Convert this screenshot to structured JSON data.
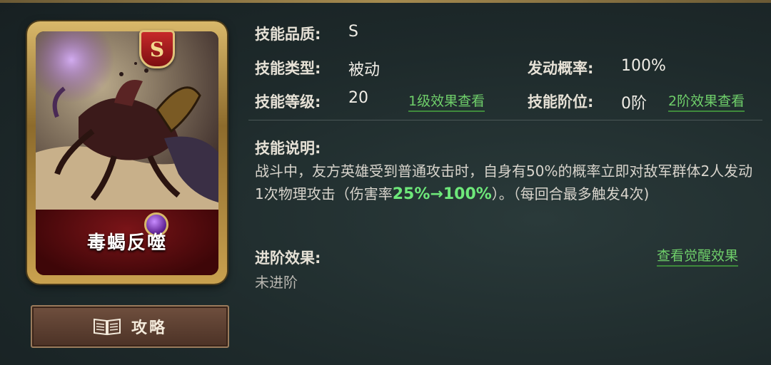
{
  "card": {
    "grade_badge": "S",
    "name": "毒蝎反噬"
  },
  "guide_button": {
    "label": "攻略",
    "icon": "book-icon"
  },
  "info": {
    "quality_label": "技能品质:",
    "quality_value": "S",
    "type_label": "技能类型:",
    "type_value": "被动",
    "chance_label": "发动概率:",
    "chance_value": "100%",
    "level_label": "技能等级:",
    "level_value": "20",
    "level1_link": "1级效果查看",
    "rank_label": "技能阶位:",
    "rank_value": "0阶",
    "rank2_link": "2阶效果查看"
  },
  "description": {
    "label": "技能说明:",
    "text_part1": "战斗中，友方英雄受到普通攻击时，自身有50%的概率立即对敌军群体2人发动1次物理攻击（伤害率",
    "highlight": "25%→100%",
    "text_part2": "）。（每回合最多触发4次)"
  },
  "advancement": {
    "label": "进阶效果:",
    "value": "未进阶",
    "awaken_link": "查看觉醒效果"
  },
  "colors": {
    "link_green": "#6fcf6a",
    "highlight_green": "#6ee87a",
    "card_frame_gold": "#c9a14f",
    "name_panel_red": "#7a1418"
  }
}
